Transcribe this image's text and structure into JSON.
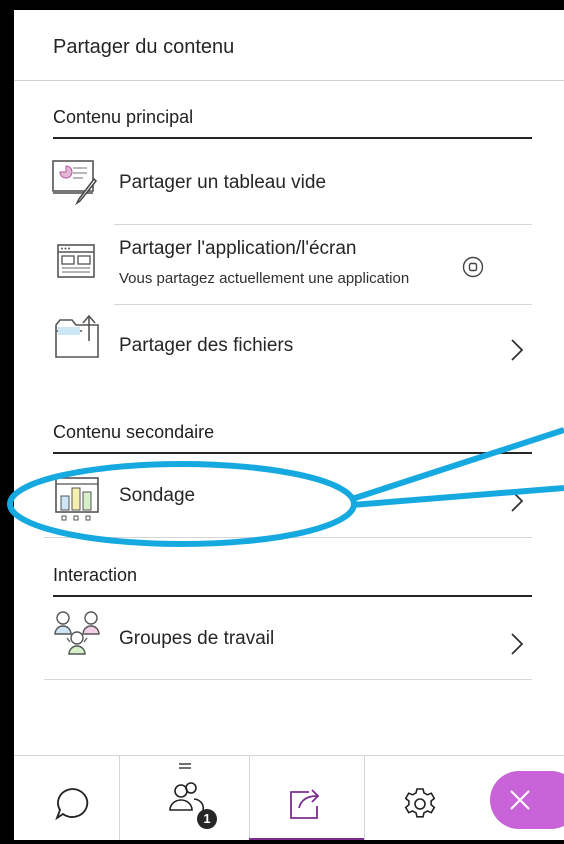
{
  "panel": {
    "title": "Partager du contenu"
  },
  "sections": {
    "primary": {
      "title": "Contenu principal",
      "items": {
        "whiteboard": {
          "label": "Partager un tableau vide",
          "icon": "whiteboard-icon"
        },
        "app_screen": {
          "label": "Partager l'application/l'écran",
          "sublabel": "Vous partagez actuellement une application",
          "icon": "application-screen-icon",
          "action_icon": "stop-sharing-icon"
        },
        "files": {
          "label": "Partager des fichiers",
          "icon": "folder-upload-icon"
        }
      }
    },
    "secondary": {
      "title": "Contenu secondaire",
      "items": {
        "poll": {
          "label": "Sondage",
          "icon": "poll-chart-icon"
        }
      }
    },
    "interaction": {
      "title": "Interaction",
      "items": {
        "groups": {
          "label": "Groupes de travail",
          "icon": "breakout-groups-icon"
        }
      }
    }
  },
  "bottom_bar": {
    "chat": {
      "icon": "chat-bubble-icon"
    },
    "attendees": {
      "icon": "attendees-icon",
      "badge": "1"
    },
    "share": {
      "icon": "share-content-icon",
      "active": true
    },
    "settings": {
      "icon": "gear-icon"
    },
    "leave": {
      "icon": "close-icon"
    }
  },
  "colors": {
    "accent_purple": "#7b2e8e",
    "leave_button": "#c864d8",
    "callout": "#16a9e0"
  }
}
